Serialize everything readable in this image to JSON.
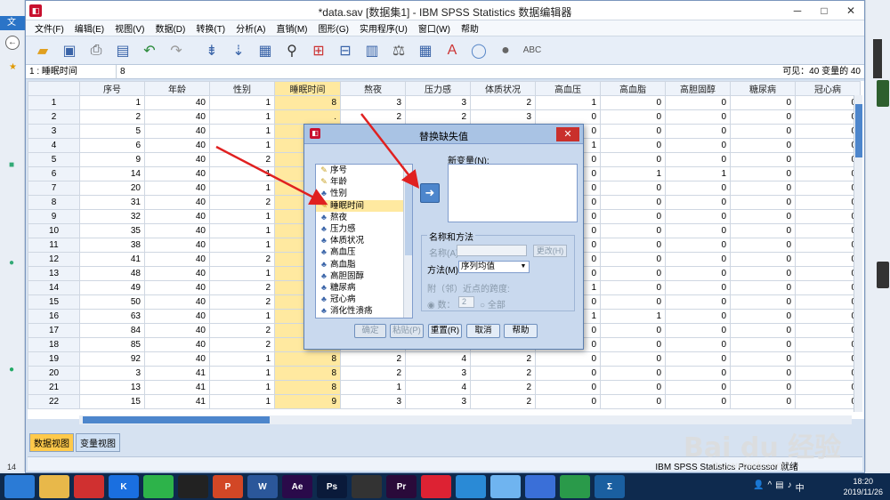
{
  "window": {
    "title": "*data.sav [数据集1] - IBM SPSS Statistics 数据编辑器",
    "min": "─",
    "max": "□",
    "close": "✕"
  },
  "menu": [
    "文件(F)",
    "编辑(E)",
    "视图(V)",
    "数据(D)",
    "转换(T)",
    "分析(A)",
    "直销(M)",
    "图形(G)",
    "实用程序(U)",
    "窗口(W)",
    "帮助"
  ],
  "toolbar_icons": [
    "open-folder-icon",
    "save-icon",
    "print-icon",
    "dialog-recall-icon",
    "undo-icon",
    "redo-icon",
    "goto-case-icon",
    "goto-variable-icon",
    "variables-icon",
    "find-icon",
    "insert-cases-icon",
    "insert-variable-icon",
    "split-file-icon",
    "weight-cases-icon",
    "select-cases-icon",
    "value-labels-icon",
    "use-sets-icon",
    "show-all-icon",
    "spell-check-icon"
  ],
  "cell_editor": {
    "ref": "1 : 睡眠时间",
    "value": "8",
    "visible": "可见：40 变量的 40"
  },
  "grid": {
    "columns": [
      "序号",
      "年龄",
      "性别",
      "睡眠时间",
      "熬夜",
      "压力感",
      "体质状况",
      "高血压",
      "高血脂",
      "高胆固醇",
      "糖尿病",
      "冠心病"
    ],
    "rows": [
      [
        "1",
        "1",
        "40",
        "1",
        "8",
        "3",
        "3",
        "2",
        "1",
        "0",
        "0",
        "0",
        "0"
      ],
      [
        "2",
        "2",
        "40",
        "1",
        ".",
        "2",
        "2",
        "3",
        "0",
        "0",
        "0",
        "0",
        "0"
      ],
      [
        "3",
        "5",
        "40",
        "1",
        "",
        "",
        "",
        "",
        "0",
        "0",
        "0",
        "0",
        "0"
      ],
      [
        "4",
        "6",
        "40",
        "1",
        "",
        "",
        "",
        "",
        "1",
        "0",
        "0",
        "0",
        "0"
      ],
      [
        "5",
        "9",
        "40",
        "2",
        "",
        "",
        "",
        "",
        "0",
        "0",
        "0",
        "0",
        "0"
      ],
      [
        "6",
        "14",
        "40",
        "1",
        "",
        "",
        "",
        "",
        "0",
        "1",
        "1",
        "0",
        "0"
      ],
      [
        "7",
        "20",
        "40",
        "1",
        "",
        "",
        "",
        "",
        "0",
        "0",
        "0",
        "0",
        "0"
      ],
      [
        "8",
        "31",
        "40",
        "2",
        "",
        "",
        "",
        "",
        "0",
        "0",
        "0",
        "0",
        "0"
      ],
      [
        "9",
        "32",
        "40",
        "1",
        "",
        "",
        "",
        "",
        "0",
        "0",
        "0",
        "0",
        "0"
      ],
      [
        "10",
        "35",
        "40",
        "1",
        "",
        "",
        "",
        "",
        "0",
        "0",
        "0",
        "0",
        "0"
      ],
      [
        "11",
        "38",
        "40",
        "1",
        "",
        "",
        "",
        "",
        "0",
        "0",
        "0",
        "0",
        "0"
      ],
      [
        "12",
        "41",
        "40",
        "2",
        "",
        "",
        "",
        "",
        "0",
        "0",
        "0",
        "0",
        "0"
      ],
      [
        "13",
        "48",
        "40",
        "1",
        "",
        "",
        "",
        "",
        "0",
        "0",
        "0",
        "0",
        "0"
      ],
      [
        "14",
        "49",
        "40",
        "2",
        "",
        "",
        "",
        "",
        "1",
        "0",
        "0",
        "0",
        "0"
      ],
      [
        "15",
        "50",
        "40",
        "2",
        "",
        "",
        "",
        "",
        "0",
        "0",
        "0",
        "0",
        "0"
      ],
      [
        "16",
        "63",
        "40",
        "1",
        "",
        "",
        "",
        "",
        "1",
        "1",
        "0",
        "0",
        "0"
      ],
      [
        "17",
        "84",
        "40",
        "2",
        "",
        "",
        "",
        "",
        "0",
        "0",
        "0",
        "0",
        "0"
      ],
      [
        "18",
        "85",
        "40",
        "2",
        "",
        "",
        "",
        "",
        "0",
        "0",
        "0",
        "0",
        "0"
      ],
      [
        "19",
        "92",
        "40",
        "1",
        "8",
        "2",
        "4",
        "2",
        "0",
        "0",
        "0",
        "0",
        "0"
      ],
      [
        "20",
        "3",
        "41",
        "1",
        "8",
        "2",
        "3",
        "2",
        "0",
        "0",
        "0",
        "0",
        "0"
      ],
      [
        "21",
        "13",
        "41",
        "1",
        "8",
        "1",
        "4",
        "2",
        "0",
        "0",
        "0",
        "0",
        "0"
      ],
      [
        "22",
        "15",
        "41",
        "1",
        "9",
        "3",
        "3",
        "2",
        "0",
        "0",
        "0",
        "0",
        "0"
      ]
    ]
  },
  "tabs": {
    "data_view": "数据视图",
    "variable_view": "变量视图"
  },
  "status": "IBM SPSS Statistics Processor 就绪",
  "dialog": {
    "title": "替换缺失值",
    "close": "✕",
    "variables": [
      {
        "name": "序号",
        "type": "scale"
      },
      {
        "name": "年龄",
        "type": "scale"
      },
      {
        "name": "性别",
        "type": "nominal"
      },
      {
        "name": "睡眠时间",
        "type": "scale"
      },
      {
        "name": "熬夜",
        "type": "nominal"
      },
      {
        "name": "压力感",
        "type": "nominal"
      },
      {
        "name": "体质状况",
        "type": "nominal"
      },
      {
        "name": "高血压",
        "type": "nominal"
      },
      {
        "name": "高血脂",
        "type": "nominal"
      },
      {
        "name": "高胆固醇",
        "type": "nominal"
      },
      {
        "name": "糖尿病",
        "type": "nominal"
      },
      {
        "name": "冠心病",
        "type": "nominal"
      },
      {
        "name": "消化性溃疡",
        "type": "nominal"
      }
    ],
    "selected_variable": "睡眠时间",
    "move_arrow": "➜",
    "new_variables_label": "新变量(N):",
    "group_label": "名称和方法",
    "name_label": "名称(A):",
    "change_button": "更改(H)",
    "method_label": "方法(M):",
    "method_value": "序列均值",
    "span_label": "附（邻）近点的跨度:",
    "number_option": "数：",
    "number_value": "2",
    "all_option": "全部",
    "buttons": {
      "ok": "确定",
      "paste": "粘贴(P)",
      "reset": "重置(R)",
      "cancel": "取消",
      "help": "帮助"
    }
  },
  "watermark": "Bai du 经验",
  "watermark_url": "jingyan.baidu.com",
  "taskbar": {
    "apps": [
      "browser-icon",
      "file-explorer-icon",
      "netease-music-icon",
      "kugou-icon",
      "wechat-icon",
      "qq-icon",
      "powerpoint-icon",
      "word-icon",
      "after-effects-icon",
      "photoshop-icon",
      "premiere-media-icon",
      "premiere-icon",
      "sketch-app-icon",
      "chat-bubble-icon",
      "feishu-icon",
      "star-app-icon",
      "wechat-work-icon",
      "spss-icon"
    ],
    "app_labels": [
      "",
      "",
      "",
      "K",
      "",
      "",
      "P",
      "W",
      "Ae",
      "Ps",
      "",
      "Pr",
      "",
      "",
      "",
      "",
      "",
      "Σ"
    ],
    "time": "18:20",
    "date": "2019/11/26",
    "tray_ime": "中"
  },
  "desktop": {
    "left_tab": "文",
    "left_number": "14"
  }
}
